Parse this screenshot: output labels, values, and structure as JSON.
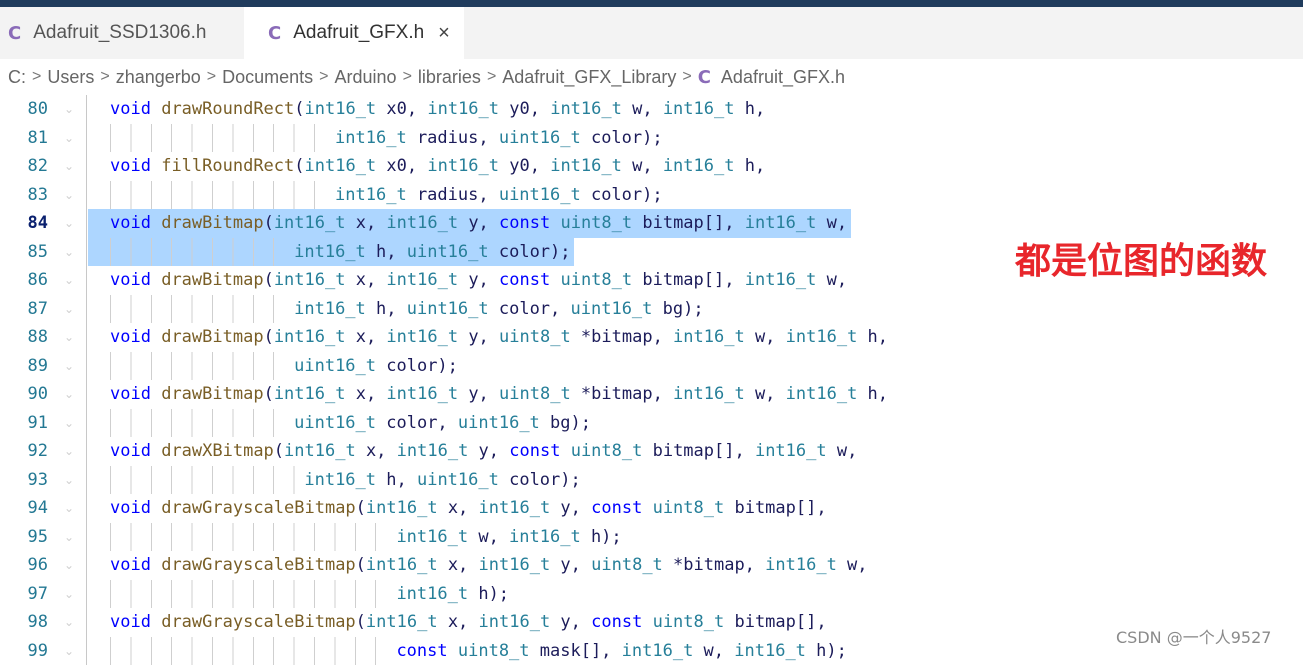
{
  "tabs": [
    {
      "icon": "c-file-icon",
      "icon_text": "C",
      "label": "Adafruit_SSD1306.h",
      "active": false
    },
    {
      "icon": "c-file-icon",
      "icon_text": "C",
      "label": "Adafruit_GFX.h",
      "active": true,
      "close": "×"
    }
  ],
  "breadcrumb": {
    "items": [
      "C:",
      "Users",
      "zhangerbo",
      "Documents",
      "Arduino",
      "libraries",
      "Adafruit_GFX_Library"
    ],
    "file_icon": "C",
    "file": "Adafruit_GFX.h",
    "separator": ">"
  },
  "editor": {
    "lines": [
      {
        "num": "80",
        "text": "void drawRoundRect(int16_t x0, int16_t y0, int16_t w, int16_t h,"
      },
      {
        "num": "81",
        "text": "int16_t radius, uint16_t color);"
      },
      {
        "num": "82",
        "text": "void fillRoundRect(int16_t x0, int16_t y0, int16_t w, int16_t h,"
      },
      {
        "num": "83",
        "text": "int16_t radius, uint16_t color);"
      },
      {
        "num": "84",
        "text": "void drawBitmap(int16_t x, int16_t y, const uint8_t bitmap[], int16_t w,"
      },
      {
        "num": "85",
        "text": "int16_t h, uint16_t color);"
      },
      {
        "num": "86",
        "text": "void drawBitmap(int16_t x, int16_t y, const uint8_t bitmap[], int16_t w,"
      },
      {
        "num": "87",
        "text": "int16_t h, uint16_t color, uint16_t bg);"
      },
      {
        "num": "88",
        "text": "void drawBitmap(int16_t x, int16_t y, uint8_t *bitmap, int16_t w, int16_t h,"
      },
      {
        "num": "89",
        "text": "uint16_t color);"
      },
      {
        "num": "90",
        "text": "void drawBitmap(int16_t x, int16_t y, uint8_t *bitmap, int16_t w, int16_t h,"
      },
      {
        "num": "91",
        "text": "uint16_t color, uint16_t bg);"
      },
      {
        "num": "92",
        "text": "void drawXBitmap(int16_t x, int16_t y, const uint8_t bitmap[], int16_t w,"
      },
      {
        "num": "93",
        "text": "int16_t h, uint16_t color);"
      },
      {
        "num": "94",
        "text": "void drawGrayscaleBitmap(int16_t x, int16_t y, const uint8_t bitmap[],"
      },
      {
        "num": "95",
        "text": "int16_t w, int16_t h);"
      },
      {
        "num": "96",
        "text": "void drawGrayscaleBitmap(int16_t x, int16_t y, uint8_t *bitmap, int16_t w,"
      },
      {
        "num": "97",
        "text": "int16_t h);"
      },
      {
        "num": "98",
        "text": "void drawGrayscaleBitmap(int16_t x, int16_t y, const uint8_t bitmap[],"
      },
      {
        "num": "99",
        "text": "const uint8_t mask[], int16_t w, int16_t h);"
      }
    ],
    "active_line": "84",
    "selected_lines": [
      "84",
      "85"
    ]
  },
  "annotation": "都是位图的函数",
  "watermark": "CSDN @一个人9527",
  "colors": {
    "keyword": "#0000ff",
    "function": "#795e26",
    "type": "#267f99",
    "selection": "#add6ff",
    "annotation": "#e8262b",
    "line_number": "#237893"
  }
}
